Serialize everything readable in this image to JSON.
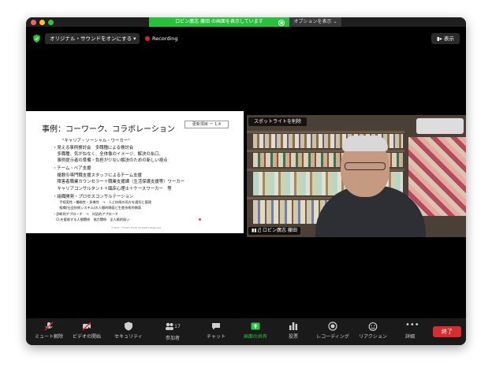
{
  "titlebar": {
    "share_banner": "ロビン廣志 藤田 の画面を表示しています",
    "options": "オプションを表示 ⌄"
  },
  "topbar": {
    "audio_button": "オリジナル・サウンドをオンにする ▾",
    "recording": "Recording",
    "view_button": "表示"
  },
  "slide": {
    "title": "事例：コーワーク、コラボレーション",
    "badge": "更新項目 ー 1,4",
    "lines": [
      "\"キャリア・ソーシャル・ワーカー\"",
      "・見える事例検討会　多職種による検討会",
      "　多職種、気がねなく、全体像のイメージ、解決の糸口、",
      "　事例提示者の準備・負担が少ない解決のための新しい視点",
      "・チーム・ペア支援",
      "　複数の専門職支援スタッフによるチーム支援",
      "　障害者職業カウンセラー＋職業支援課（生活保護支援等）ワーカー",
      "　キャリアコンサルタント＋臨床心理士＋ケースワーカー　等",
      "・組織開発・プロセスコンサルテーション",
      "　　手続実性・職務性・多様性　→　人と技術の両方を適切に管理",
      "　　組織(社会技術システム)の人間的側面と生産技術的側面",
      "・診断的アプローチ　→　対話的アプローチ",
      "　CLを援助する人間関係　協力関係　全人格的扱い"
    ],
    "footer": "©2025 · Hiroshi Fujita All Rights Reserved"
  },
  "video": {
    "spotlight_label": "スポットライトを削除",
    "participant_name": "ロビン廣志 藤田"
  },
  "toolbar": {
    "mute": "ミュート解除",
    "video": "ビデオの開始",
    "security": "セキュリティ",
    "participants": "参加者",
    "participant_count": "17",
    "chat": "チャット",
    "share": "画面の共有",
    "polls": "投票",
    "recording": "レコーディング",
    "reactions": "リアクション",
    "more": "詳細",
    "end": "終了"
  },
  "colors": {
    "green": "#26c23a",
    "red": "#d92d2d",
    "recording_dot": "#e0242c"
  }
}
